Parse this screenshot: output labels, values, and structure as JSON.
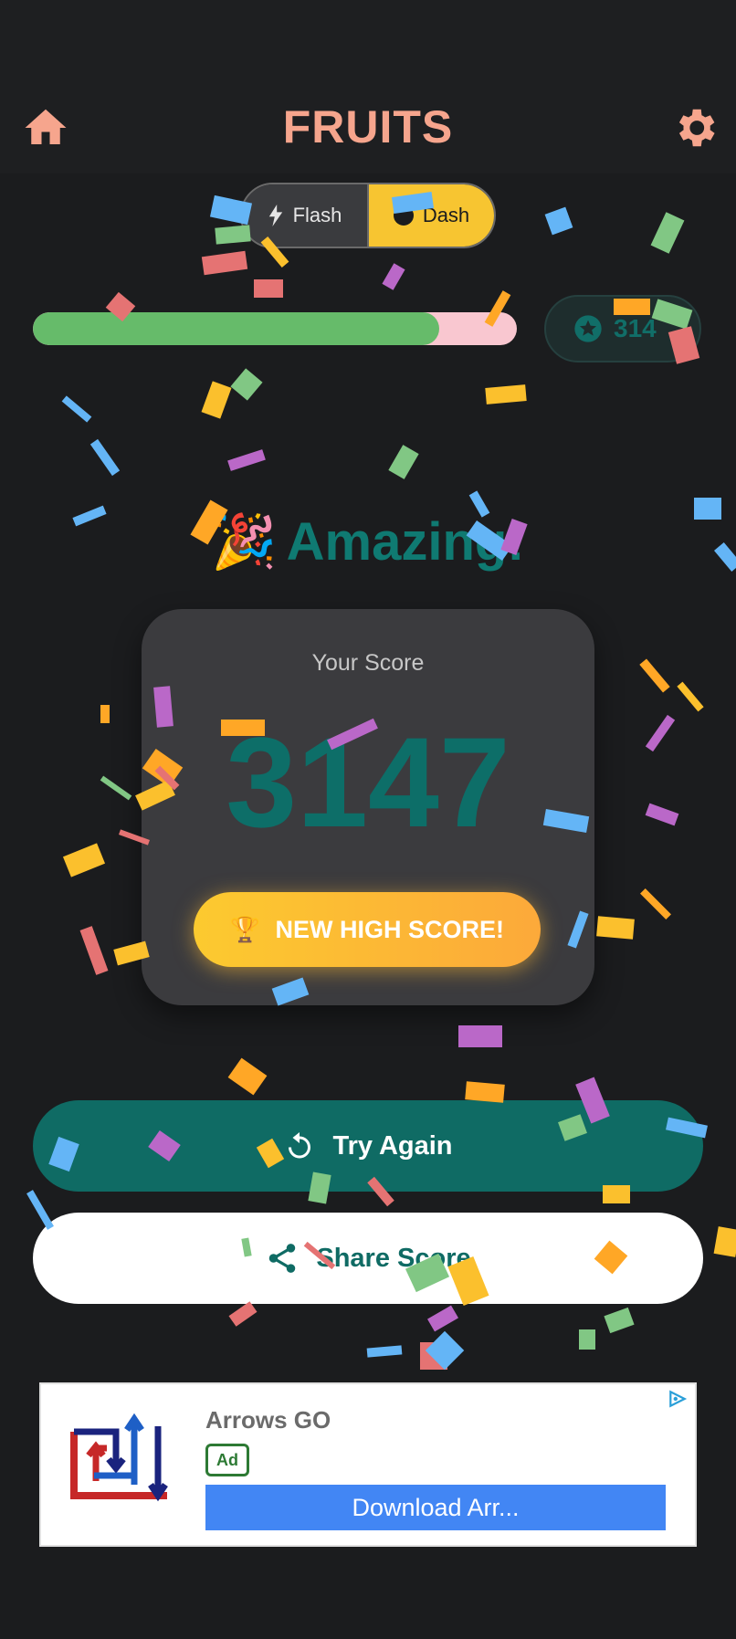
{
  "header": {
    "title": "FRUITS"
  },
  "mode_toggle": {
    "options": [
      "Flash",
      "Dash"
    ],
    "selected": "Dash"
  },
  "progress": {
    "fraction": 0.84
  },
  "score_pill": {
    "value": "314"
  },
  "celebration": {
    "emoji": "🎉",
    "text": "Amazing!"
  },
  "score_card": {
    "label": "Your Score",
    "score": "3147",
    "badge_emoji": "🏆",
    "badge_text": "NEW HIGH SCORE!"
  },
  "actions": {
    "try_again": "Try Again",
    "share": "Share Score"
  },
  "ad": {
    "title": "Arrows GO",
    "badge": "Ad",
    "cta": "Download Arr..."
  },
  "colors": {
    "accent": "#0f6b64",
    "title": "#f6a58d",
    "gold": "#fcca2f",
    "progress": "#66bb6a"
  },
  "icons": [
    "home-icon",
    "gear-icon",
    "flash-icon",
    "dash-icon",
    "star-icon",
    "trophy-icon",
    "refresh-icon",
    "share-icon",
    "ad-choices-icon"
  ]
}
